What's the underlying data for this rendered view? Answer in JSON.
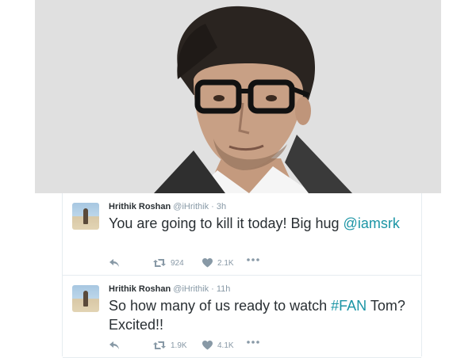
{
  "colors": {
    "link": "#1b95a5",
    "text": "#292f33",
    "muted": "#8899a6",
    "border": "#e6ecf0"
  },
  "photo": {
    "icon": "portrait-photo"
  },
  "tweets": [
    {
      "name": "Hrithik Roshan",
      "handle": "@iHrithik",
      "separator": "·",
      "time": "3h",
      "text_before": "You are going to kill it today! Big hug ",
      "text_link": "@iamsrk",
      "text_after": "",
      "retweets": "924",
      "likes": "2.1K",
      "icons": [
        "reply-icon",
        "retweet-icon",
        "heart-icon",
        "more-icon"
      ]
    },
    {
      "name": "Hrithik Roshan",
      "handle": "@iHrithik",
      "separator": "·",
      "time": "11h",
      "text_before": "So how many of us ready to watch ",
      "text_link": "#FAN",
      "text_after": " Tom? Excited!!",
      "retweets": "1.9K",
      "likes": "4.1K",
      "icons": [
        "reply-icon",
        "retweet-icon",
        "heart-icon",
        "more-icon"
      ]
    }
  ]
}
